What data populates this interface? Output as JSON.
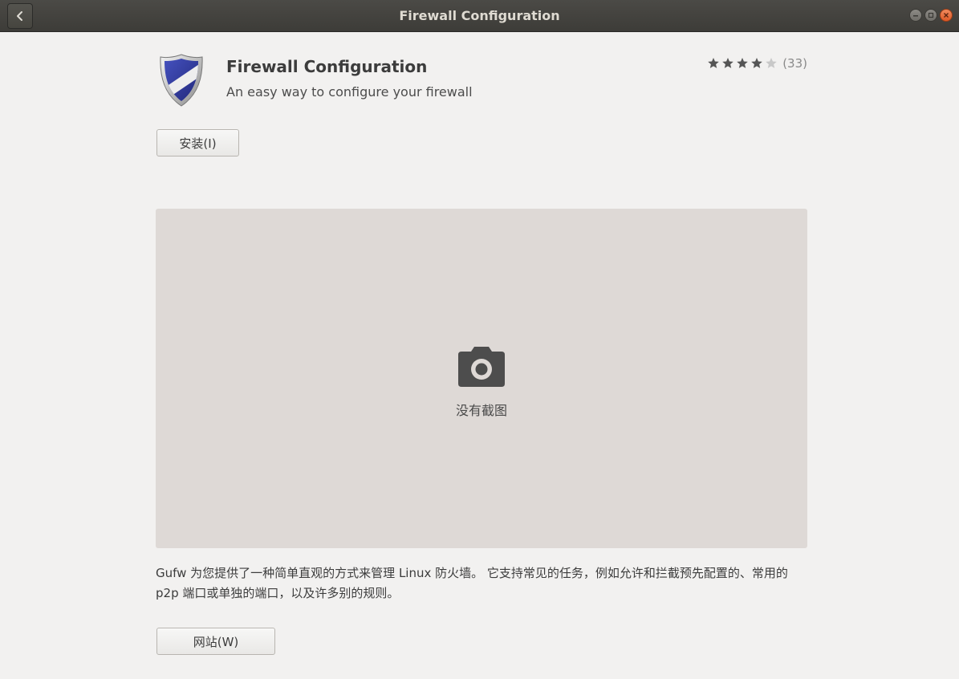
{
  "window": {
    "title": "Firewall Configuration",
    "back_icon": "chevron-left-icon",
    "controls": [
      "minimize-icon",
      "maximize-icon",
      "close-icon"
    ]
  },
  "app": {
    "icon": "shield-icon",
    "name": "Firewall Configuration",
    "summary": "An easy way to configure your firewall",
    "rating": {
      "stars": 4,
      "max_stars": 5,
      "review_count": "(33)"
    },
    "install_label": "安装(I)"
  },
  "screenshot": {
    "icon": "camera-icon",
    "placeholder": "没有截图"
  },
  "description": "Gufw 为您提供了一种简单直观的方式来管理 Linux 防火墙。 它支持常见的任务，例如允许和拦截预先配置的、常用的 p2p 端口或单独的端口，以及许多别的规则。",
  "website_label": "网站(W)",
  "colors": {
    "titlebar": "#3d3c38",
    "background": "#f2f1f0",
    "screenshot_bg": "#ded9d6",
    "close_button": "#df5a27",
    "star_filled": "#555555",
    "star_empty": "#c8c8c8"
  }
}
